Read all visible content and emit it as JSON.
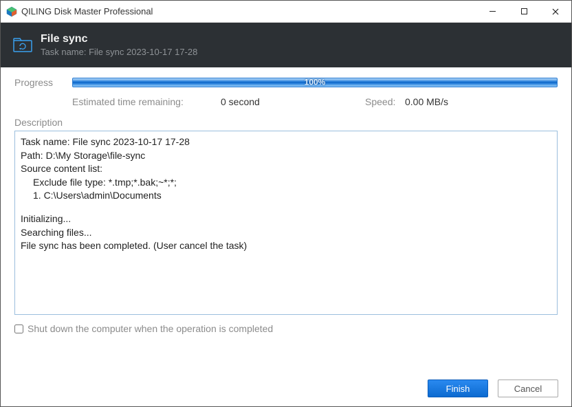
{
  "window": {
    "title": "QILING Disk Master Professional"
  },
  "header": {
    "title": "File sync",
    "subtitle": "Task name: File sync 2023-10-17 17-28"
  },
  "progress": {
    "label": "Progress",
    "percent_text": "100%",
    "eta_label": "Estimated time remaining:",
    "eta_value": "0 second",
    "speed_label": "Speed:",
    "speed_value": "0.00 MB/s"
  },
  "description": {
    "label": "Description",
    "lines": {
      "l0": "Task name: File sync 2023-10-17 17-28",
      "l1": "Path: D:\\My Storage\\file-sync",
      "l2": "Source content list:",
      "l3": "Exclude file type: *.tmp;*.bak;~*;*;",
      "l4": "1. C:\\Users\\admin\\Documents",
      "l5": "Initializing...",
      "l6": "Searching files...",
      "l7": "File sync has been completed. (User cancel the task)"
    }
  },
  "shutdown": {
    "label": "Shut down the computer when the operation is completed",
    "checked": false
  },
  "buttons": {
    "finish": "Finish",
    "cancel": "Cancel"
  }
}
